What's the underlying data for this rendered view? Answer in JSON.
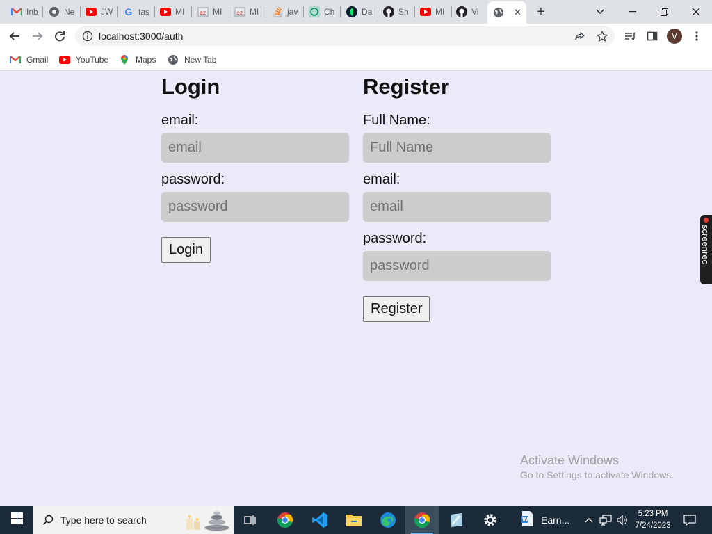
{
  "browser": {
    "tabs": [
      {
        "label": "Inb",
        "icon": "gmail-icon"
      },
      {
        "label": "Ne",
        "icon": "chrome-icon"
      },
      {
        "label": "JW",
        "icon": "youtube-icon"
      },
      {
        "label": "tas",
        "icon": "google-icon"
      },
      {
        "label": "MI",
        "icon": "youtube-icon"
      },
      {
        "label": "MI",
        "icon": "myanimelist-icon"
      },
      {
        "label": "MI",
        "icon": "myanimelist-icon"
      },
      {
        "label": "jav",
        "icon": "stackoverflow-icon"
      },
      {
        "label": "Ch",
        "icon": "chatgpt-icon"
      },
      {
        "label": "Da",
        "icon": "mongodb-icon"
      },
      {
        "label": "Sh",
        "icon": "github-icon"
      },
      {
        "label": "MI",
        "icon": "youtube-icon"
      },
      {
        "label": "Vi",
        "icon": "github-icon"
      }
    ],
    "address": "localhost:3000/auth",
    "profile_initial": "V",
    "bookmarks": [
      {
        "label": "Gmail",
        "icon": "gmail-icon"
      },
      {
        "label": "YouTube",
        "icon": "youtube-icon"
      },
      {
        "label": "Maps",
        "icon": "maps-icon"
      },
      {
        "label": "New Tab",
        "icon": "globe-icon"
      }
    ]
  },
  "login": {
    "title": "Login",
    "email_label": "email:",
    "email_placeholder": "email",
    "password_label": "password:",
    "password_placeholder": "password",
    "submit_label": "Login"
  },
  "register": {
    "title": "Register",
    "name_label": "Full Name:",
    "name_placeholder": "Full Name",
    "email_label": "email:",
    "email_placeholder": "email",
    "password_label": "password:",
    "password_placeholder": "password",
    "submit_label": "Register"
  },
  "overlay": {
    "screenrec_label": "screenrec",
    "activate_title": "Activate Windows",
    "activate_subtitle": "Go to Settings to activate Windows."
  },
  "taskbar": {
    "search_placeholder": "Type here to search",
    "word_app_label": "Earn...",
    "time": "5:23 PM",
    "date": "7/24/2023"
  },
  "colors": {
    "page_bg": "#ebeaf8",
    "input_bg": "#cccccc",
    "taskbar_bg": "#1c2b3a"
  }
}
